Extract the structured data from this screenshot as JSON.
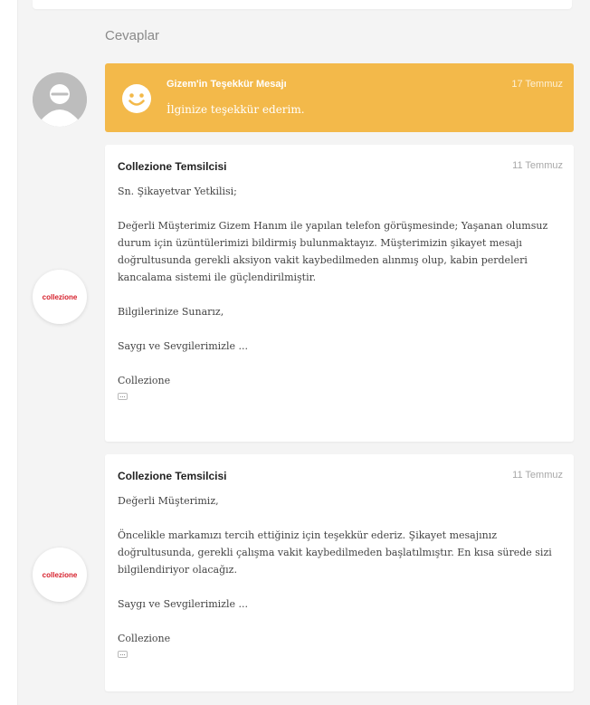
{
  "section_title": "Cevaplar",
  "thanks": {
    "title": "Gizem'in Teşekkür Mesajı",
    "date": "17 Temmuz",
    "text": "İlginize teşekkür ederim."
  },
  "brand_logo": "collezione",
  "replies": [
    {
      "author": "Collezione Temsilcisi",
      "date": "11 Temmuz",
      "paragraphs": [
        "Sn. Şikayetvar Yetkilisi;",
        "Değerli Müşterimiz Gizem Hanım ile yapılan telefon görüşmesinde; Yaşanan olumsuz durum için üzüntülerimizi bildirmiş bulunmaktayız. Müşterimizin şikayet mesajı doğrultusunda gerekli aksiyon vakit kaybedilmeden alınmış olup, kabin perdeleri kancalama sistemi ile güçlendirilmiştir.",
        "Bilgilerinize Sunarız,",
        "Saygı ve Sevgilerimizle ...",
        "Collezione"
      ]
    },
    {
      "author": "Collezione Temsilcisi",
      "date": "11 Temmuz",
      "paragraphs": [
        "Değerli Müşterimiz,",
        "Öncelikle markamızı tercih ettiğiniz için teşekkür ederiz. Şikayet mesajınız doğrultusunda, gerekli çalışma vakit kaybedilmeden başlatılmıştır. En kısa sürede sizi bilgilendiriyor olacağız.",
        "Saygı ve Sevgilerimizle ...",
        "Collezione"
      ]
    }
  ],
  "colors": {
    "accent": "#f3b94a",
    "brand_red": "#d6202c"
  },
  "icons": [
    "user-avatar-icon",
    "smiley-icon",
    "more-dots-icon"
  ]
}
